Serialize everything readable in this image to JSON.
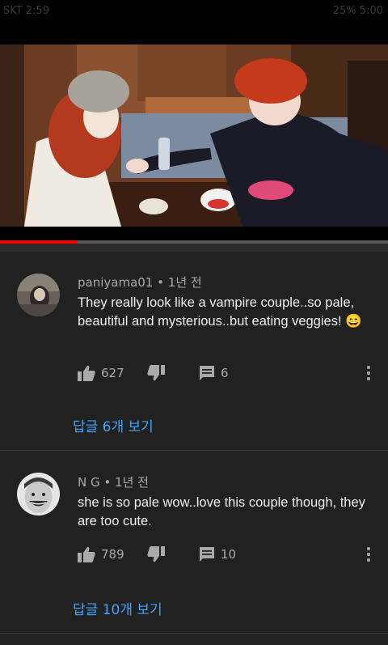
{
  "status_bar": {
    "left_text": "SKT 2:59",
    "right_text": "25% 5:00"
  },
  "video": {
    "progress_fraction": 0.2
  },
  "comments": [
    {
      "author": "paniyama01",
      "separator": "•",
      "age": "1년 전",
      "text": "They really look like a vampire couple..so pale, beautiful and mysterious..but eating veggies! 😄",
      "likes": "627",
      "replies_count": "6",
      "replies_link": "답글 6개 보기"
    },
    {
      "author": "N G",
      "separator": "•",
      "age": "1년 전",
      "text": "she is so pale wow..love this couple though, they are too cute.",
      "likes": "789",
      "replies_count": "10",
      "replies_link": "답글 10개 보기"
    }
  ],
  "icons": {
    "like": "thumbs-up-icon",
    "dislike": "thumbs-down-icon",
    "reply": "reply-comment-icon",
    "more": "more-vertical-icon"
  },
  "colors": {
    "background": "#212121",
    "link": "#3ea6ff",
    "progress": "#ff0000"
  }
}
